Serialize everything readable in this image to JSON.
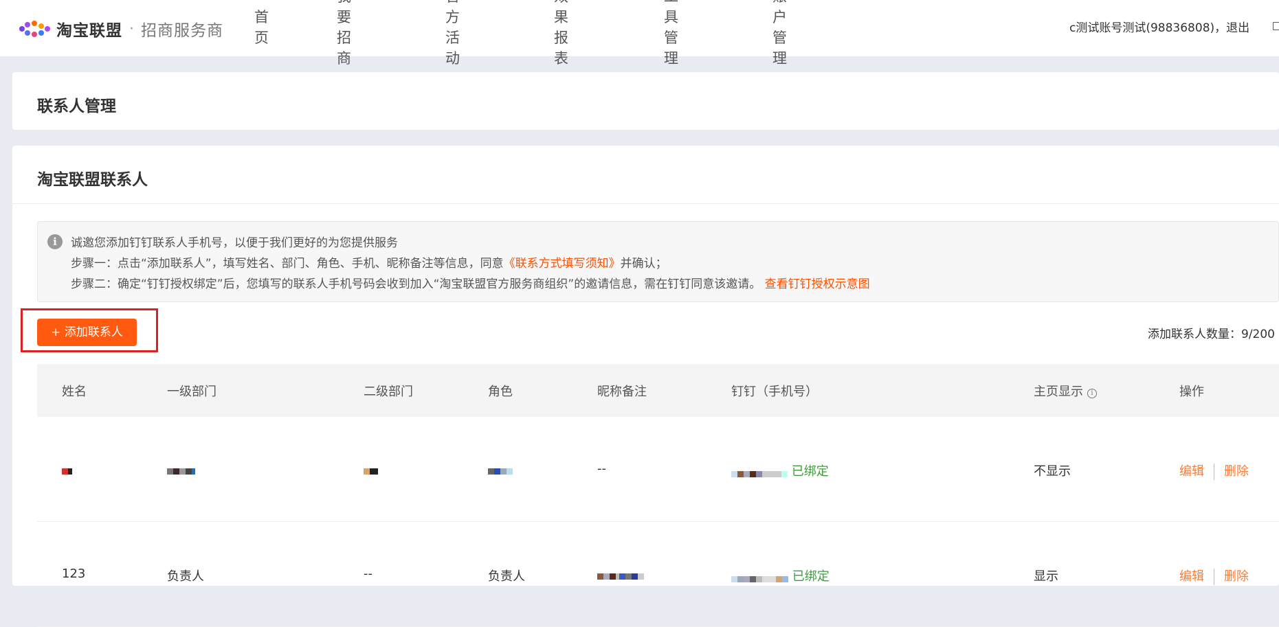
{
  "header": {
    "brand": "淘宝联盟",
    "separator": "·",
    "subtitle": "招商服务商",
    "nav": [
      "首页",
      "我要招商",
      "官方活动",
      "效果报表",
      "工具管理",
      "账户管理"
    ],
    "user_text": "c测试账号测试(98836808)，退出"
  },
  "page_title": "联系人管理",
  "section_title": "淘宝联盟联系人",
  "notice": {
    "line1": "诚邀您添加钉钉联系人手机号，以便于我们更好的为您提供服务",
    "line2_prefix": "步骤一：点击“添加联系人”，填写姓名、部门、角色、手机、昵称备注等信息，同意",
    "line2_link": "《联系方式填写须知》",
    "line2_suffix": "并确认；",
    "line3_prefix": "步骤二：确定“钉钉授权绑定”后，您填写的联系人手机号码会收到加入“淘宝联盟官方服务商组织”的邀请信息，需在钉钉同意该邀请。",
    "line3_link": "查看钉钉授权示意图"
  },
  "add_button": "+ 添加联系人",
  "count_text": "添加联系人数量：9/200",
  "table": {
    "headers": [
      "姓名",
      "一级部门",
      "二级部门",
      "角色",
      "昵称备注",
      "钉钉（手机号）",
      "主页显示",
      "操作"
    ],
    "rows": [
      {
        "nickname": "--",
        "bind_status": "已绑定",
        "homepage": "不显示",
        "edit": "编辑",
        "delete": "删除"
      },
      {
        "name": "123",
        "dept1": "负责人",
        "dept2": "--",
        "role": "负责人",
        "bind_status": "已绑定",
        "homepage": "显示",
        "edit": "编辑",
        "delete": "删除"
      }
    ]
  },
  "colors": {
    "accent": "#ff5a0f",
    "link": "#ff5000",
    "bound": "#3a9f3a",
    "highlight": "#e02020"
  }
}
